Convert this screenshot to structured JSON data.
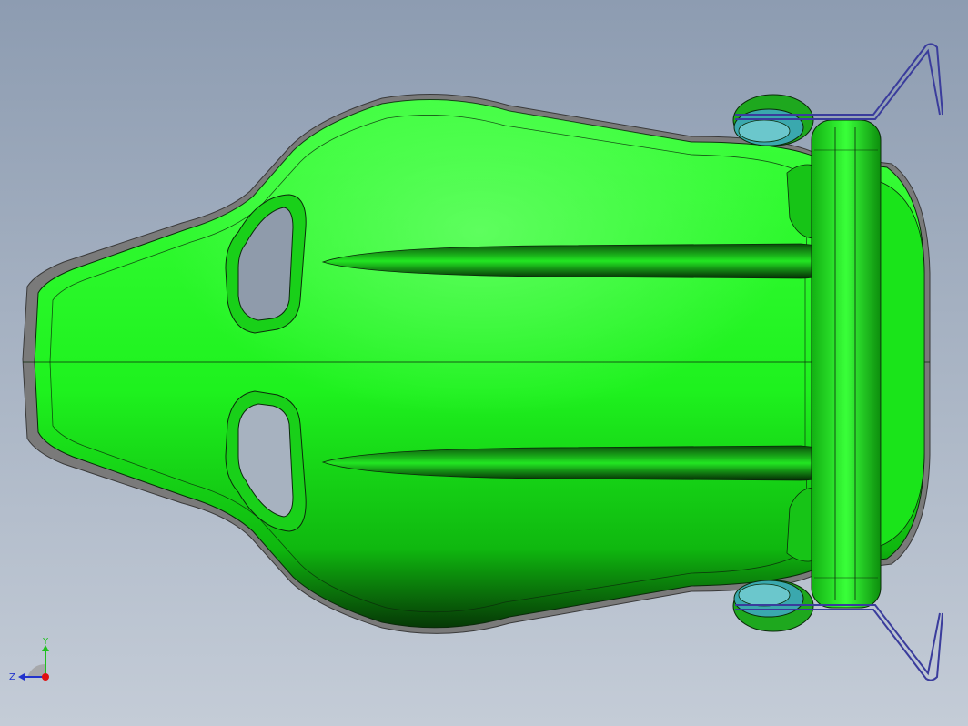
{
  "viewport": {
    "background_top": "#8d9cb1",
    "background_bottom": "#c4ccd7"
  },
  "model": {
    "body_color": "#1ef21e",
    "body_shadow_color": "#0a3a0a",
    "shell_edge_color": "#6e6e6e",
    "wheel_color": "#4fb8bf",
    "frame_color": "#3a3c9c",
    "edge_line_color": "#0b2a0b"
  },
  "triad": {
    "y_label": "Y",
    "z_label": "Z",
    "y_color": "#20c020",
    "z_color": "#2233cc",
    "x_color": "#e01010"
  }
}
